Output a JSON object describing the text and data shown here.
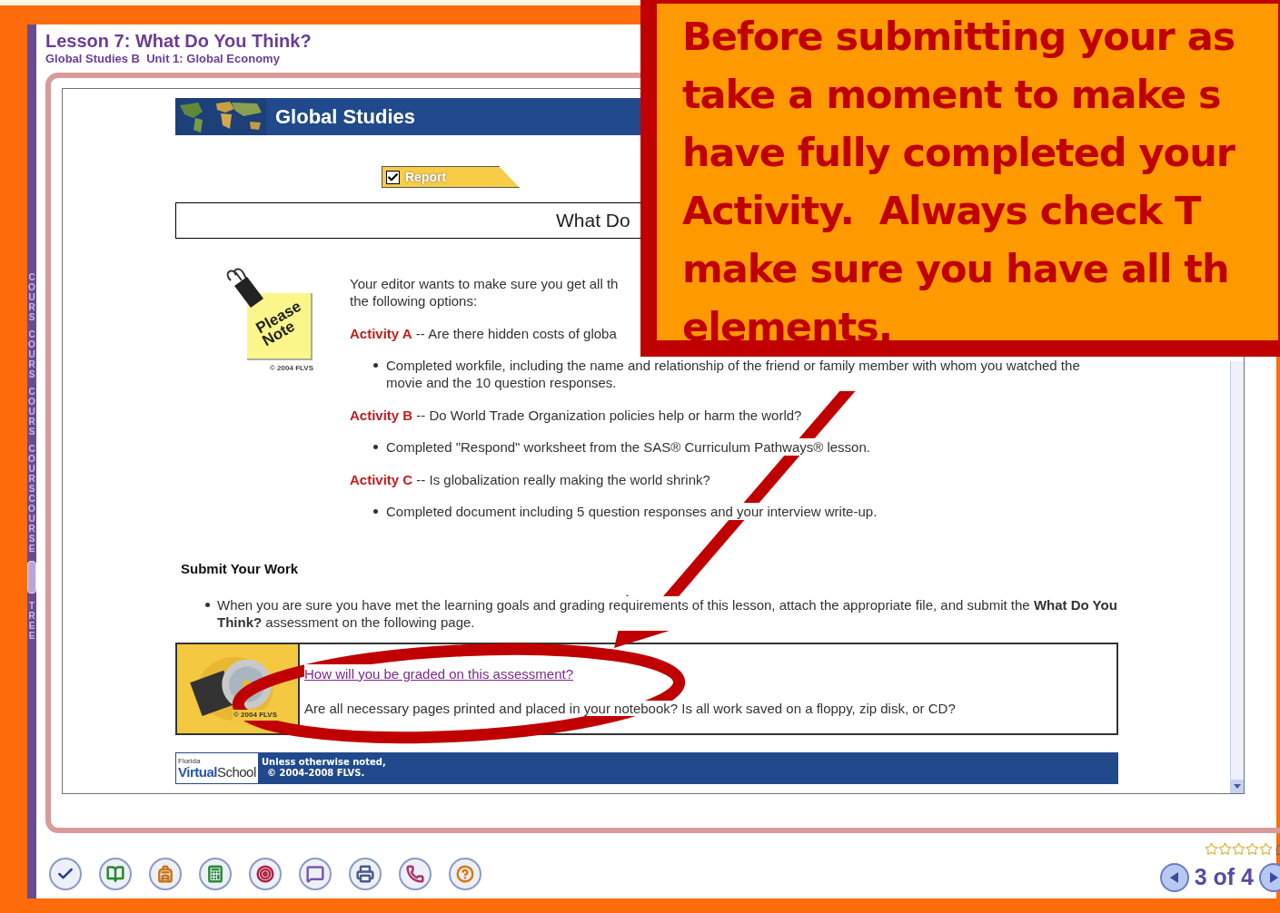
{
  "side_strip": {
    "labels": [
      "COURS",
      "COURS",
      "COURS",
      "COURSCOURSE",
      "TREE"
    ]
  },
  "header": {
    "title": "Lesson 7: What Do You Think?",
    "subtitle": "Global Studies B  Unit 1: Global Economy"
  },
  "banner": {
    "title": "Global Studies"
  },
  "tab": {
    "label": "Report",
    "checked": true
  },
  "section_heading": "What Do",
  "note": {
    "label_1": "Please",
    "label_2": "Note",
    "credit": "© 2004 FLVS"
  },
  "intro": [
    "Your editor wants to make sure you get all th",
    "the following options:"
  ],
  "activities": [
    {
      "name": "Activity A",
      "question": " -- Are there hidden costs of globa",
      "requirement": "Completed workfile, including the name and relationship of the friend or family member with whom you watched the movie and the 10 question responses."
    },
    {
      "name": "Activity B",
      "question": " -- Do World Trade Organization policies help or harm the world?",
      "requirement": "Completed \"Respond\" worksheet from the SAS® Curriculum Pathways® lesson."
    },
    {
      "name": "Activity C",
      "question": " -- Is globalization really making the world shrink?",
      "requirement": "Completed document including 5 question responses and your interview write-up."
    }
  ],
  "submit": {
    "heading": "Submit Your Work",
    "text": "When you are sure you have met the learning goals and grading requirements of this lesson, attach the appropriate file, and submit the **What Do You Think?** assessment on the following page."
  },
  "assessment": {
    "credit": "© 2004 FLVS",
    "link": "How will you be graded on this assessment?",
    "text": "Are all necessary pages printed and placed in your notebook? Is all work saved on a floppy, zip disk, or CD?"
  },
  "footer": {
    "logo_small": "Florida",
    "logo_a": "Virtual",
    "logo_b": "School",
    "notice_1": "Unless otherwise noted,",
    "notice_2": "© 2004-2008 FLVS."
  },
  "rating": {
    "stars": 0
  },
  "pager": {
    "text": "3 of 4"
  },
  "callout": {
    "lines": [
      "Before submitting your as",
      "take a moment to make s",
      "have fully completed your",
      "Activity.  Always check T",
      "make sure you have all th",
      "elements."
    ]
  }
}
